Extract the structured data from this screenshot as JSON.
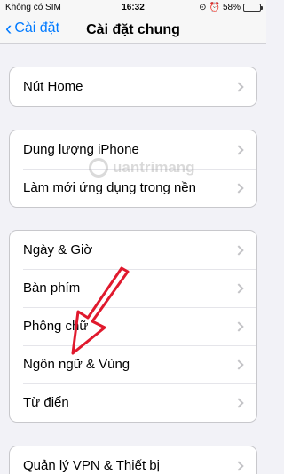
{
  "status_bar": {
    "carrier": "Không có SIM",
    "time": "16:32",
    "battery": "58%",
    "battery_level": 0.58
  },
  "nav": {
    "back_label": "Cài đặt",
    "title": "Cài đặt chung"
  },
  "groups": [
    {
      "items": [
        {
          "label": "Nút Home"
        }
      ]
    },
    {
      "items": [
        {
          "label": "Dung lượng iPhone"
        },
        {
          "label": "Làm mới ứng dụng trong nền"
        }
      ]
    },
    {
      "items": [
        {
          "label": "Ngày & Giờ"
        },
        {
          "label": "Bàn phím"
        },
        {
          "label": "Phông chữ"
        },
        {
          "label": "Ngôn ngữ & Vùng"
        },
        {
          "label": "Từ điển"
        }
      ]
    },
    {
      "items": [
        {
          "label": "Quản lý VPN & Thiết bị"
        }
      ]
    }
  ],
  "watermark": "uantrimang",
  "annotation": {
    "color": "#e0192d",
    "icon": "red-arrow-annotation"
  }
}
